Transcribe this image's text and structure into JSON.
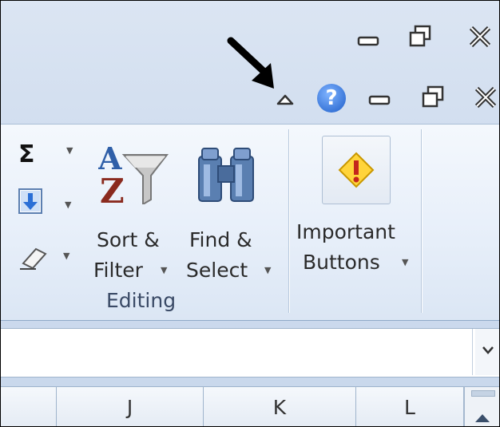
{
  "window_controls": {
    "minimize": "▭",
    "restore": "🗗",
    "close": "✕"
  },
  "help_label": "?",
  "collapse_ribbon_icon": "collapse-ribbon-icon",
  "editing": {
    "sum_symbol": "Σ",
    "sort_filter": {
      "line1": "Sort &",
      "line2": "Filter"
    },
    "find_select": {
      "line1": "Find &",
      "line2": "Select"
    },
    "group_label": "Editing"
  },
  "custom_group": {
    "line1": "Important",
    "line2": "Buttons"
  },
  "columns": [
    "J",
    "K",
    "L"
  ]
}
